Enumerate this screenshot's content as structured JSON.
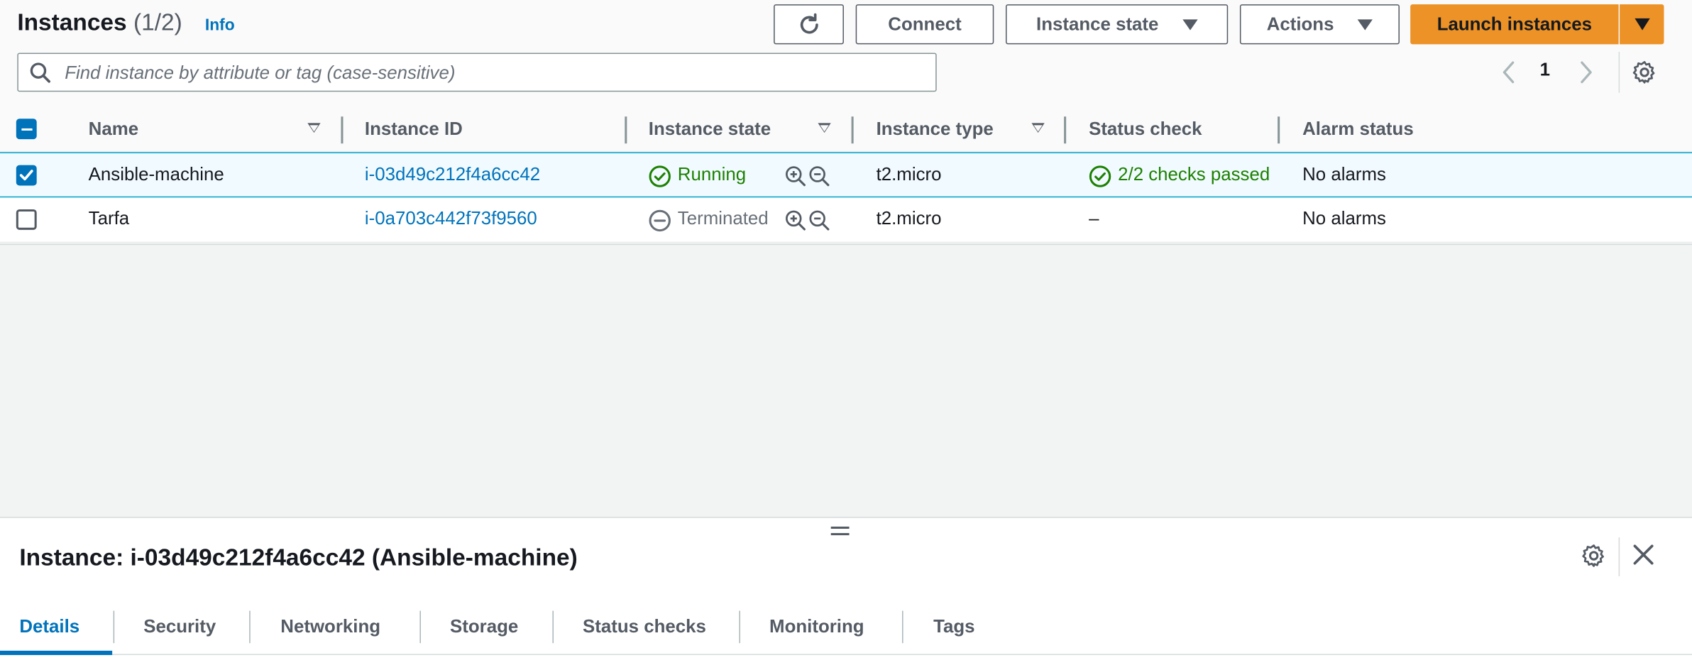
{
  "header": {
    "title": "Instances",
    "count": "(1/2)",
    "info_link": "Info",
    "refresh_icon": "refresh-icon",
    "connect_label": "Connect",
    "instance_state_label": "Instance state",
    "actions_label": "Actions",
    "launch_label": "Launch instances",
    "accent_color": "#ec9226"
  },
  "search": {
    "placeholder": "Find instance by attribute or tag (case-sensitive)"
  },
  "pagination": {
    "current_page": "1"
  },
  "table": {
    "columns": [
      "Name",
      "Instance ID",
      "Instance state",
      "Instance type",
      "Status check",
      "Alarm status"
    ],
    "rows": [
      {
        "selected": true,
        "name": "Ansible-machine",
        "instance_id": "i-03d49c212f4a6cc42",
        "state": "Running",
        "state_icon": "check-circle-icon",
        "type": "t2.micro",
        "status_check": "2/2 checks passed",
        "alarm_status": "No alarms"
      },
      {
        "selected": false,
        "name": "Tarfa",
        "instance_id": "i-0a703c442f73f9560",
        "state": "Terminated",
        "state_icon": "minus-circle-icon",
        "type": "t2.micro",
        "status_check": "–",
        "alarm_status": "No alarms"
      }
    ]
  },
  "details": {
    "title": "Instance: i-03d49c212f4a6cc42 (Ansible-machine)",
    "tabs": [
      "Details",
      "Security",
      "Networking",
      "Storage",
      "Status checks",
      "Monitoring",
      "Tags"
    ],
    "active_tab": "Details"
  }
}
